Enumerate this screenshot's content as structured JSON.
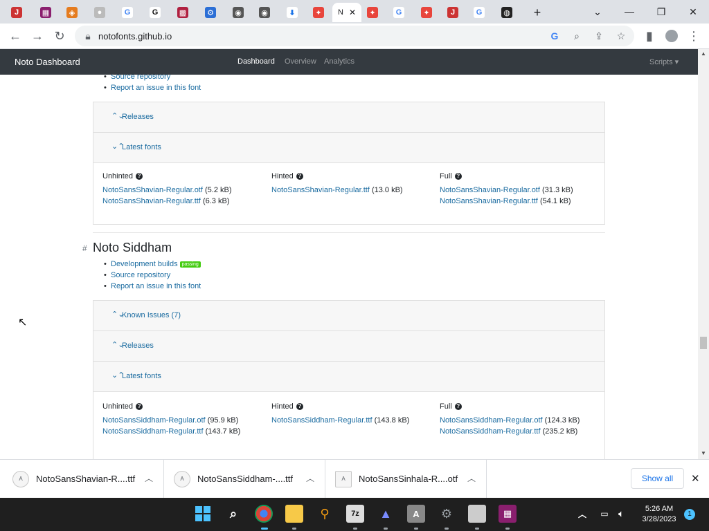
{
  "browser": {
    "active_tab_label": "N",
    "url": "notofonts.github.io",
    "window_controls": [
      "chevron-down-icon",
      "minimize-icon",
      "restore-icon",
      "close-icon"
    ]
  },
  "site": {
    "brand": "Noto Dashboard",
    "nav": [
      "Dashboard",
      "Overview",
      "Analytics"
    ],
    "scripts_menu": "Scripts"
  },
  "top_links": [
    "Source repository",
    "Report an issue in this font"
  ],
  "shavian": {
    "releases_label": "Releases",
    "latest_label": "Latest fonts",
    "col_unhinted": "Unhinted",
    "col_hinted": "Hinted",
    "col_full": "Full",
    "unhinted_files": [
      {
        "name": "NotoSansShavian-Regular.otf",
        "size": "(5.2 kB)"
      },
      {
        "name": "NotoSansShavian-Regular.ttf",
        "size": "(6.3 kB)"
      }
    ],
    "hinted_files": [
      {
        "name": "NotoSansShavian-Regular.ttf",
        "size": "(13.0 kB)"
      }
    ],
    "full_files": [
      {
        "name": "NotoSansShavian-Regular.otf",
        "size": "(31.3 kB)"
      },
      {
        "name": "NotoSansShavian-Regular.ttf",
        "size": "(54.1 kB)"
      }
    ]
  },
  "siddham": {
    "anchor": "#",
    "title": "Noto Siddham",
    "links": [
      "Development builds",
      "Source repository",
      "Report an issue in this font"
    ],
    "badge": "passing",
    "known_issues_label": "Known Issues (7)",
    "releases_label": "Releases",
    "latest_label": "Latest fonts",
    "col_unhinted": "Unhinted",
    "col_hinted": "Hinted",
    "col_full": "Full",
    "unhinted_files": [
      {
        "name": "NotoSansSiddham-Regular.otf",
        "size": "(95.9 kB)"
      },
      {
        "name": "NotoSansSiddham-Regular.ttf",
        "size": "(143.7 kB)"
      }
    ],
    "hinted_files": [
      {
        "name": "NotoSansSiddham-Regular.ttf",
        "size": "(143.8 kB)"
      }
    ],
    "full_files": [
      {
        "name": "NotoSansSiddham-Regular.otf",
        "size": "(124.3 kB)"
      },
      {
        "name": "NotoSansSiddham-Regular.ttf",
        "size": "(235.2 kB)"
      }
    ]
  },
  "downloads": {
    "items": [
      "NotoSansShavian-R....ttf",
      "NotoSansSiddham-....ttf",
      "NotoSansSinhala-R....otf"
    ],
    "show_all": "Show all"
  },
  "taskbar": {
    "time": "5:26 AM",
    "date": "3/28/2023",
    "notification_count": "1",
    "sevenzip_label": "7z"
  },
  "colors": {
    "link": "#1a6ba0",
    "navbar": "#343a40",
    "badge": "#44cc11",
    "taskbar": "#1f1f1f"
  }
}
